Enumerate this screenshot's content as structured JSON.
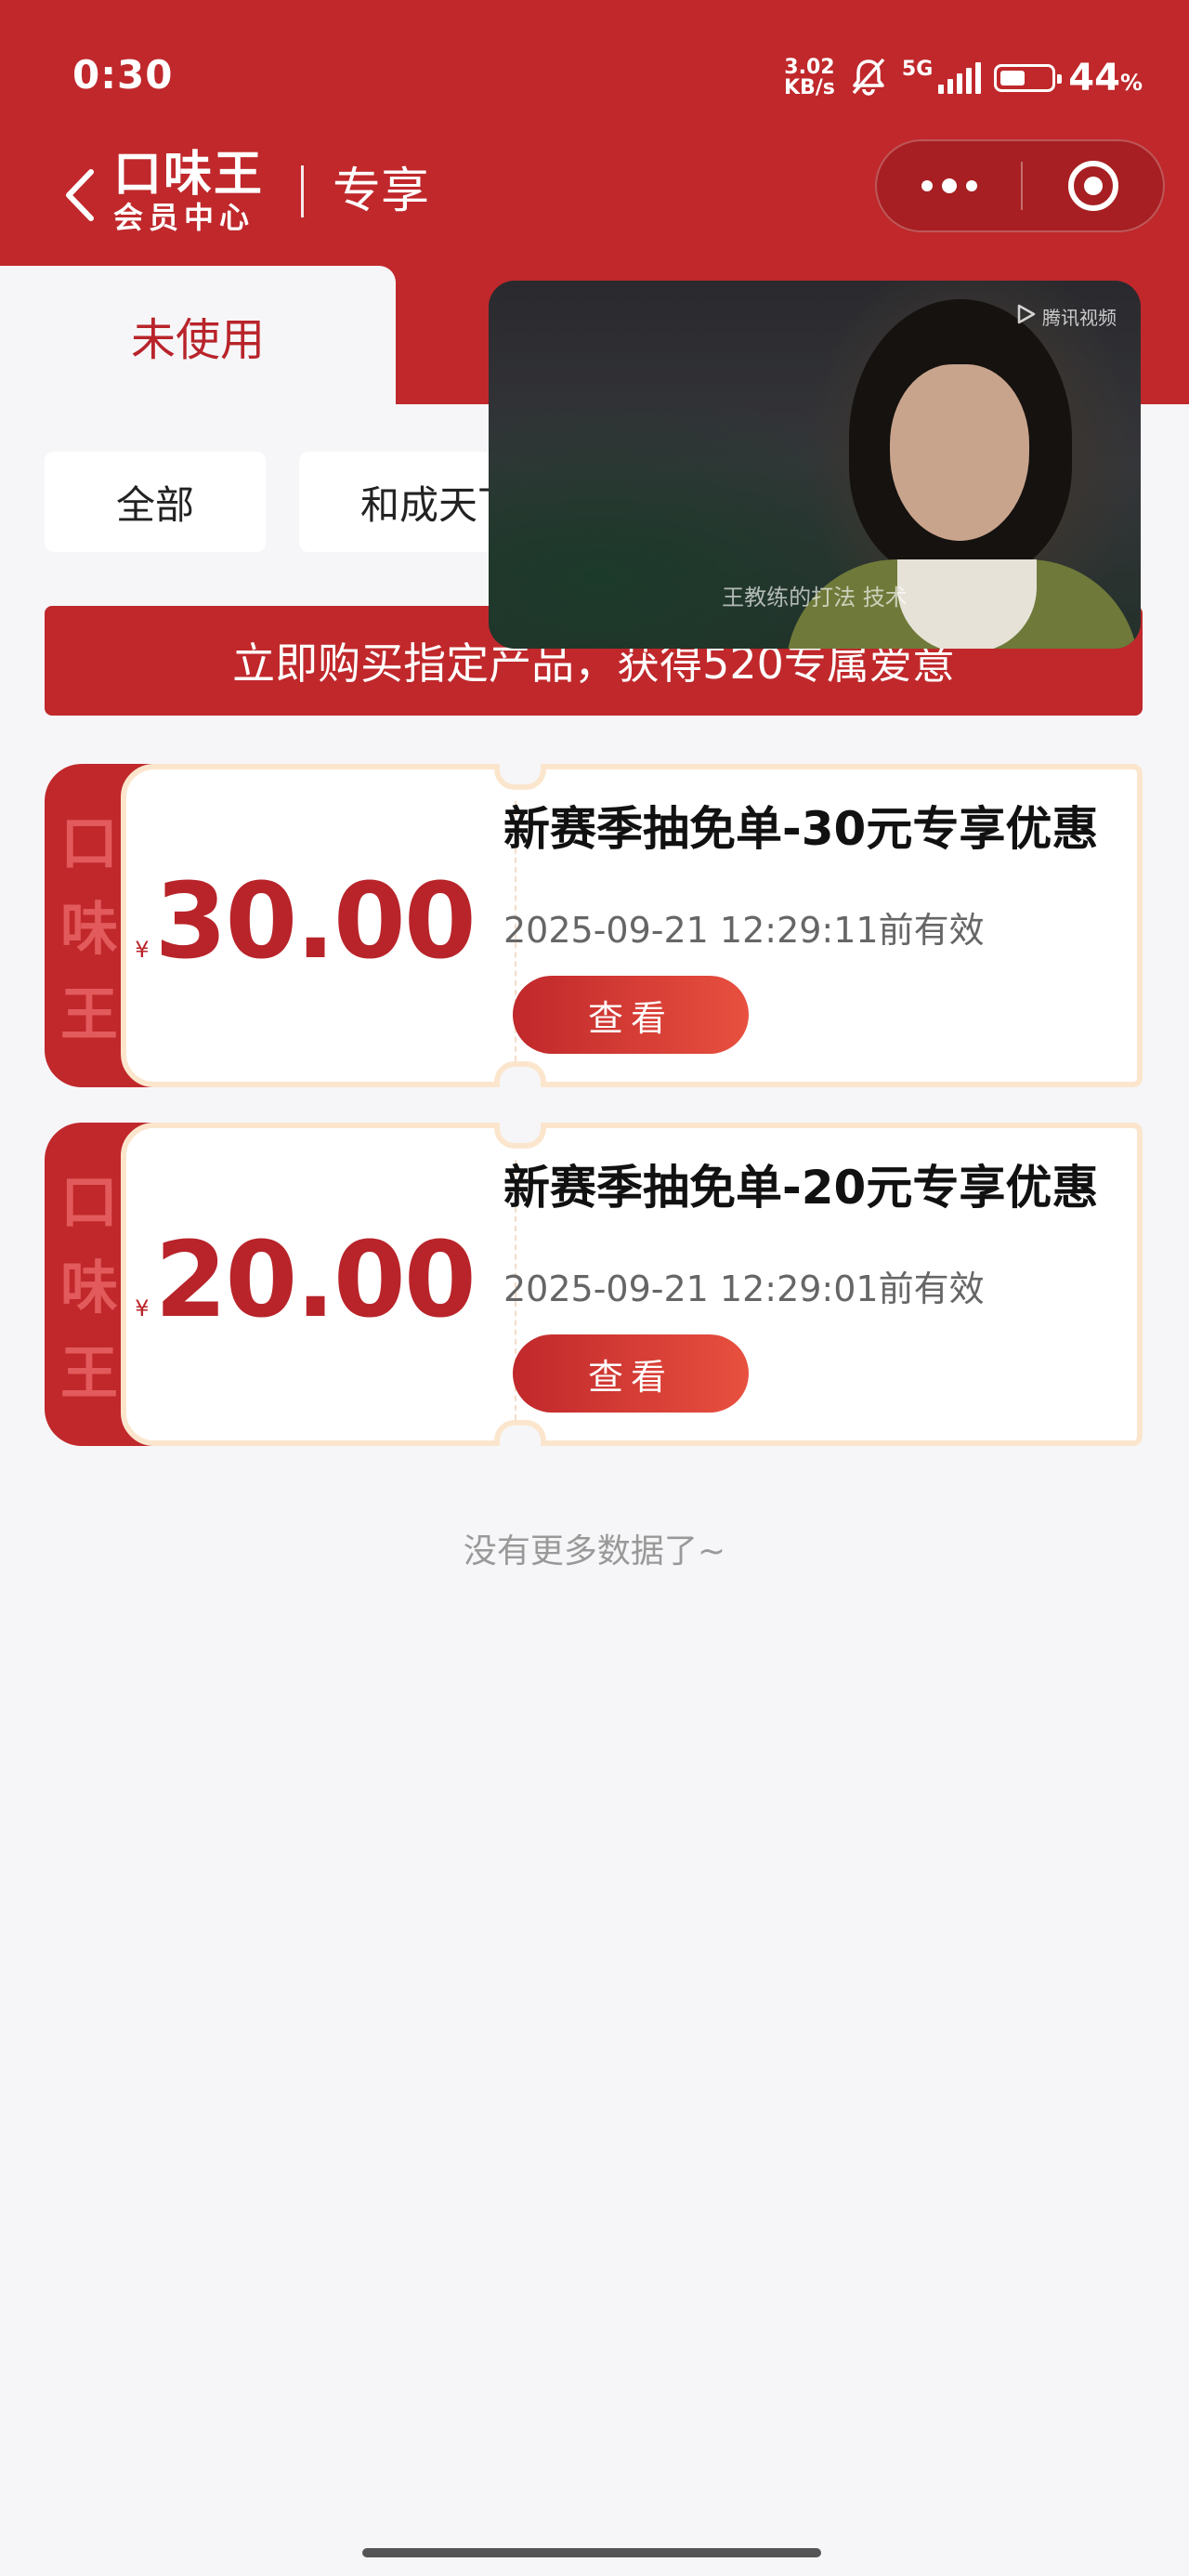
{
  "status_bar": {
    "time": "0:30",
    "net_speed_value": "3.02",
    "net_speed_unit": "KB/s",
    "network": "5G",
    "battery_percent": "44",
    "battery_unit": "%"
  },
  "nav": {
    "logo_main": "口味王",
    "logo_sub": "会员中心",
    "title": "专享"
  },
  "tabs": [
    {
      "label": "未使用",
      "active": true
    },
    {
      "label": "",
      "active": false
    }
  ],
  "filters": [
    {
      "label": "全部"
    },
    {
      "label": "和成天下"
    }
  ],
  "promo_banner": "立即购买指定产品，获得520专属爱意",
  "coupons": [
    {
      "stub_text": "口味王",
      "currency": "¥",
      "amount": "30.00",
      "title": "新赛季抽免单-30元专享优惠",
      "expiry": "2025-09-21 12:29:11前有效",
      "button": "查看"
    },
    {
      "stub_text": "口味王",
      "currency": "¥",
      "amount": "20.00",
      "title": "新赛季抽免单-20元专享优惠",
      "expiry": "2025-09-21 12:29:01前有效",
      "button": "查看"
    }
  ],
  "no_more": "没有更多数据了~",
  "video": {
    "watermark": "腾讯视频",
    "caption": "王教练的打法 技术"
  },
  "colors": {
    "brand_red": "#c0282b",
    "coupon_border": "#fbe6cd",
    "background": "#f6f6f8"
  },
  "icons": [
    "back-icon",
    "more-dots-icon",
    "capsule-close-icon",
    "mute-bell-icon",
    "signal-icon",
    "battery-icon",
    "play-logo-icon"
  ]
}
